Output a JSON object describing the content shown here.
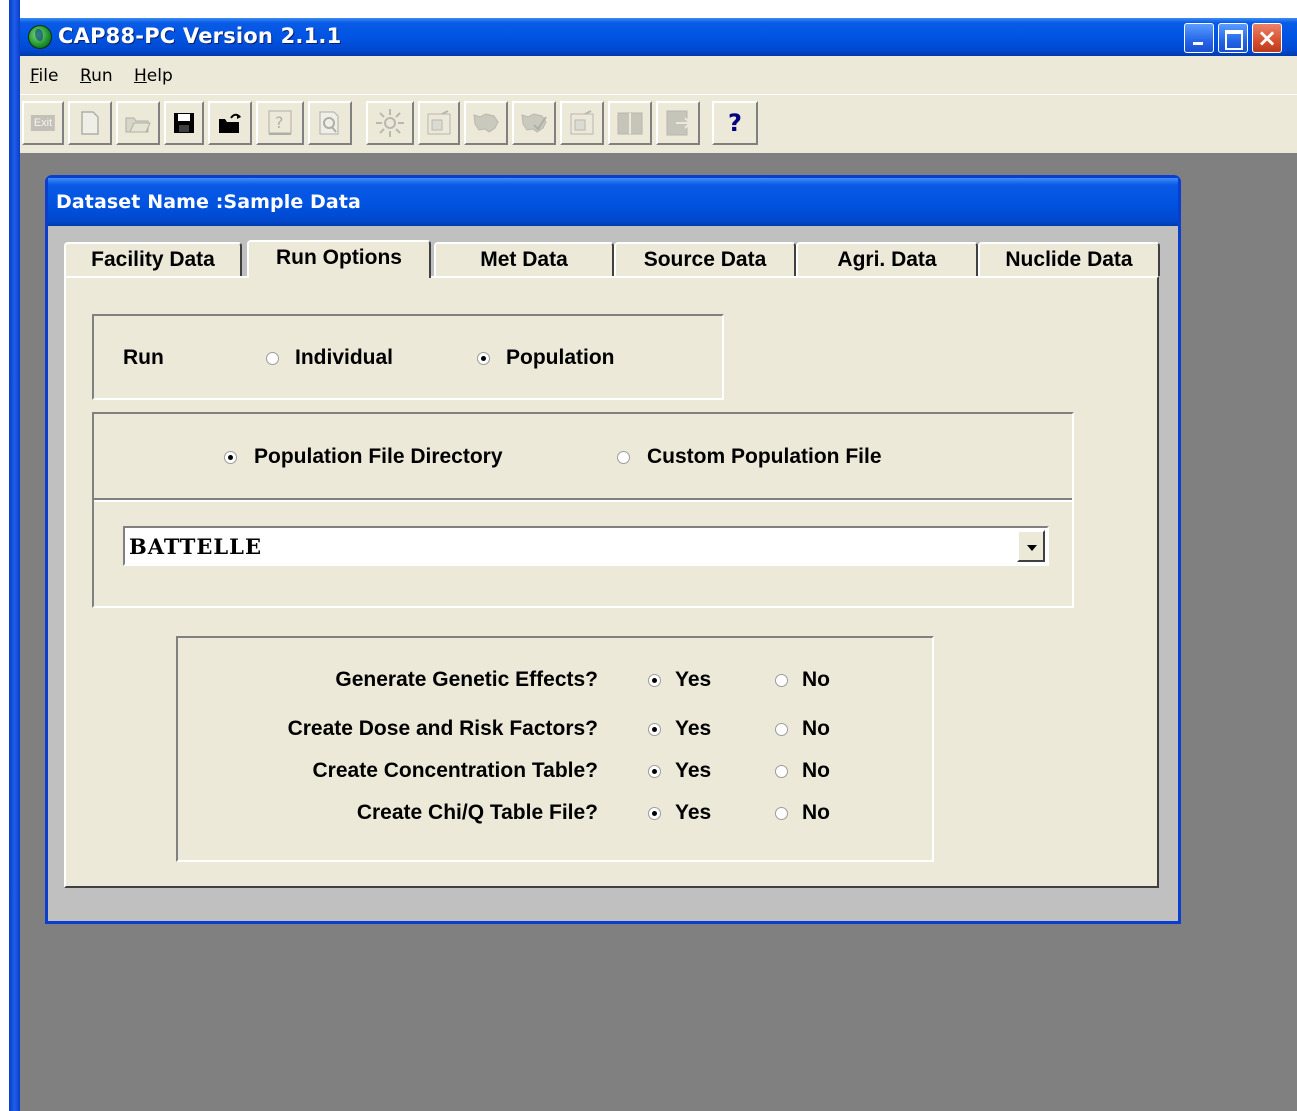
{
  "window": {
    "title": "CAP88-PC Version 2.1.1",
    "icon": "globe-icon"
  },
  "menu": {
    "items": [
      {
        "label": "File",
        "mnemonic": "F"
      },
      {
        "label": "Run",
        "mnemonic": "R"
      },
      {
        "label": "Help",
        "mnemonic": "H"
      }
    ]
  },
  "toolbar": {
    "exit_label": "Exit",
    "help_label": "?",
    "buttons": [
      {
        "name": "exit-button",
        "enabled": false
      },
      {
        "name": "new-document-button",
        "enabled": false
      },
      {
        "name": "open-folder-button",
        "enabled": false
      },
      {
        "name": "save-button",
        "enabled": true
      },
      {
        "name": "open-file-button",
        "enabled": true
      },
      {
        "name": "help-file-button",
        "enabled": false
      },
      {
        "name": "print-preview-button",
        "enabled": false
      },
      {
        "name": "run-sun-button",
        "enabled": false
      },
      {
        "name": "data-form-button",
        "enabled": false
      },
      {
        "name": "map-button",
        "enabled": false
      },
      {
        "name": "map-2-button",
        "enabled": false
      },
      {
        "name": "data-form-2-button",
        "enabled": false
      },
      {
        "name": "book-button",
        "enabled": false
      },
      {
        "name": "exit-door-button",
        "enabled": false
      },
      {
        "name": "help-button",
        "enabled": true
      }
    ]
  },
  "dataset": {
    "title": "Dataset Name :Sample Data"
  },
  "tabs": [
    {
      "label": "Facility Data",
      "active": false
    },
    {
      "label": "Run Options",
      "active": true
    },
    {
      "label": "Met Data",
      "active": false
    },
    {
      "label": "Source Data",
      "active": false
    },
    {
      "label": "Agri. Data",
      "active": false
    },
    {
      "label": "Nuclide Data",
      "active": false
    }
  ],
  "run": {
    "label": "Run",
    "options": [
      {
        "label": "Individual",
        "selected": false
      },
      {
        "label": "Population",
        "selected": true
      }
    ]
  },
  "population": {
    "options": [
      {
        "label": "Population File Directory",
        "selected": true
      },
      {
        "label": "Custom Population File",
        "selected": false
      }
    ],
    "directory_value": "BATTELLE"
  },
  "effects": {
    "yes_label": "Yes",
    "no_label": "No",
    "rows": [
      {
        "question": "Generate Genetic Effects?",
        "value": "Yes"
      },
      {
        "question": "Create Dose and Risk Factors?",
        "value": "Yes"
      },
      {
        "question": "Create Concentration Table?",
        "value": "Yes"
      },
      {
        "question": "Create Chi/Q Table File?",
        "value": "Yes"
      }
    ]
  }
}
